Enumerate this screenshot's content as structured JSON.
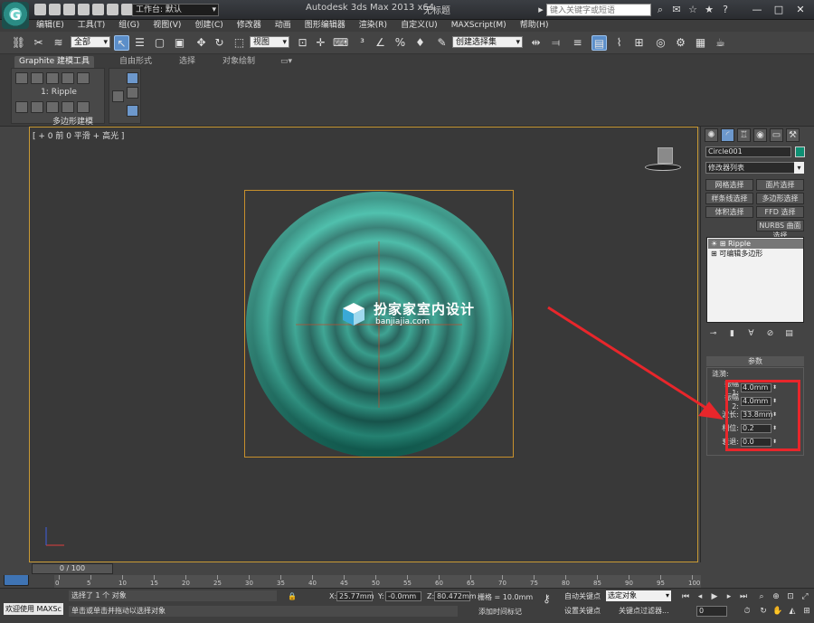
{
  "titlebar": {
    "workspace_label": "工作台: 默认",
    "app_title": "Autodesk 3ds Max  2013 x64",
    "doc_title": "无标题",
    "search_placeholder": "键入关键字或短语"
  },
  "menu": [
    "编辑(E)",
    "工具(T)",
    "组(G)",
    "视图(V)",
    "创建(C)",
    "修改器",
    "动画",
    "图形编辑器",
    "渲染(R)",
    "自定义(U)",
    "MAXScript(M)",
    "帮助(H)"
  ],
  "toolbar": {
    "filter_dropdown": "全部",
    "coord_dropdown": "视图",
    "named_sel_dropdown": "创建选择集"
  },
  "ribbon": {
    "tabs": [
      "Graphite 建模工具",
      "自由形式",
      "选择",
      "对象绘制"
    ],
    "panel_label": "1: Ripple",
    "panel_footer": "多边形建模"
  },
  "viewport": {
    "label": "[ + 0 前 0 平滑 + 高光 ]",
    "watermark_text": "扮家家室内设计",
    "watermark_url": "banjiajia.com"
  },
  "cmdpanel": {
    "object_name": "Circle001",
    "object_color": "#0e8f73",
    "modifier_list": "修改器列表",
    "sel_buttons": [
      "网格选择",
      "面片选择",
      "样条线选择",
      "多边形选择",
      "体积选择",
      "FFD 选择",
      "NURBS 曲面选择"
    ],
    "stack": [
      "Ripple",
      "可编辑多边形"
    ],
    "params_header": "参数",
    "params_group": "涟漪:",
    "params": [
      {
        "label": "振幅 1:",
        "value": "4.0mm"
      },
      {
        "label": "振幅 2:",
        "value": "4.0mm"
      },
      {
        "label": "波长:",
        "value": "33.8mm"
      },
      {
        "label": "相位:",
        "value": "0.2"
      },
      {
        "label": "衰退:",
        "value": "0.0"
      }
    ]
  },
  "timeline": {
    "slider_label": "0 / 100",
    "ticks": [
      "0",
      "5",
      "10",
      "15",
      "20",
      "25",
      "30",
      "35",
      "40",
      "45",
      "50",
      "55",
      "60",
      "65",
      "70",
      "75",
      "80",
      "85",
      "90",
      "95",
      "100"
    ]
  },
  "status": {
    "welcome": "欢迎使用 MAXSc",
    "line1": "选择了 1 个 对象",
    "line2": "单击或单击并拖动以选择对象",
    "x_label": "X:",
    "x_value": "25.77mm",
    "y_label": "Y:",
    "y_value": "-0.0mm",
    "z_label": "Z:",
    "z_value": "80.472mm",
    "grid": "栅格 = 10.0mm",
    "add_time_tag": "添加时间标记",
    "auto_key": "自动关键点",
    "set_key": "设置关键点",
    "selected_dropdown": "选定对象",
    "key_filters": "关键点过滤器...",
    "frame_value": "0"
  },
  "colors": {
    "disc": "#1f9a86",
    "selection": "#c99a34",
    "highlight": "#e8262b"
  }
}
